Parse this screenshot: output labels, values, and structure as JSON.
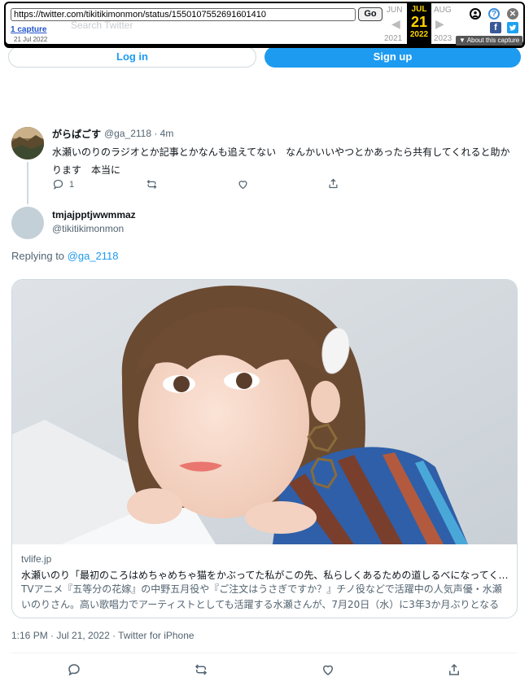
{
  "wayback": {
    "url": "https://twitter.com/tikitikimonmon/status/1550107552691601410",
    "go_label": "Go",
    "captures_label": "1 capture",
    "capture_date": "21 Jul 2022",
    "prev_month": "JUN",
    "current_month": "JUL",
    "next_month": "AUG",
    "current_day": "21",
    "prev_year": "2021",
    "current_year": "2022",
    "next_year": "2023",
    "about_label": "▼ About this capture",
    "hidden_text": "Search Twitter"
  },
  "auth": {
    "login_label": "Log in",
    "signup_label": "Sign up"
  },
  "reply_tweet": {
    "display_name": "がらぱごす",
    "meta": "@ga_2118 · 4m",
    "text": "水瀬いのりのラジオとか記事とかなんも追えてない　なんかいいやつとかあったら共有してくれると助かります　本当に",
    "reply_count": "1"
  },
  "main_tweet": {
    "display_name": "tmjajpptjwwmmaz",
    "handle": "@tikitikimonmon",
    "replying_prefix": "Replying to",
    "replying_to": "@ga_2118",
    "card": {
      "domain": "tvlife.jp",
      "title": "水瀬いのり「最初のころはめちゃめちゃ猫をかぶってた私がこの先、私らしくあるための道しるべになってくれ…",
      "description": "TVアニメ『五等分の花嫁』の中野五月役や『ご注文はうさぎですか？』チノ役などで活躍中の人気声優・水瀬いのりさん。高い歌唱力でアーティストとしても活躍する水瀬さんが、7月20日（水）に3年3か月ぶりとなる4th…"
    },
    "timestamp": "1:16 PM · Jul 21, 2022 · Twitter for iPhone"
  },
  "colors": {
    "accent": "#1d9bf0",
    "secondary_text": "#536471",
    "border": "#cfd9de"
  },
  "icons": [
    "reply-icon",
    "retweet-icon",
    "like-icon",
    "share-icon",
    "facebook-icon",
    "twitter-icon",
    "help-icon",
    "close-icon",
    "user-icon"
  ]
}
